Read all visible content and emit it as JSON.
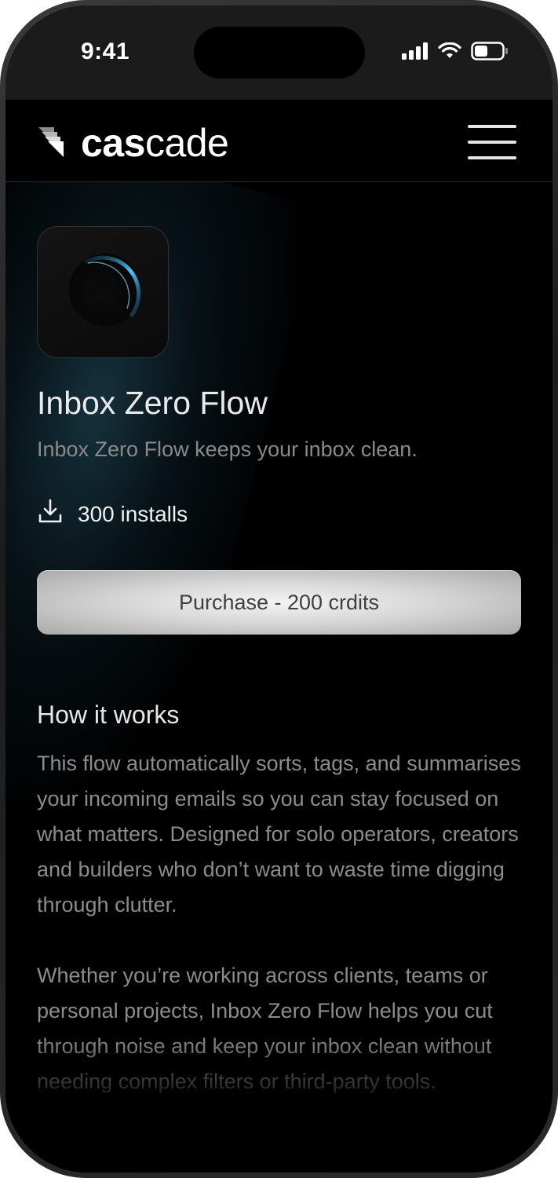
{
  "status_bar": {
    "time": "9:41",
    "icons": [
      "cellular-signal-icon",
      "wifi-icon",
      "battery-icon"
    ]
  },
  "nav": {
    "logo_bold": "cas",
    "logo_light": "cade",
    "logo_icon": "cascade-logo-icon",
    "menu_icon": "hamburger-menu-icon"
  },
  "product": {
    "icon": "planet-icon",
    "title": "Inbox Zero Flow",
    "subtitle": "Inbox Zero Flow keeps your inbox clean.",
    "installs_icon": "download-icon",
    "installs_label": "300 installs",
    "purchase_label": "Purchase - 200 crdits"
  },
  "how_it_works": {
    "heading": "How it works",
    "paragraph_1": "This flow automatically sorts, tags, and summarises your incoming emails so you can stay focused on what matters. Designed for solo operators, creators and builders who don’t want to waste time digging through clutter.",
    "paragraph_2": "Whether you’re working across clients, teams or personal projects, Inbox Zero Flow helps you cut through noise and keep your inbox clean without needing complex filters or third-party tools."
  },
  "colors": {
    "background": "#000000",
    "accent_blue": "#4fc3f7",
    "muted_text": "#8c8c8c",
    "button_silver": "#d7d7d7"
  }
}
